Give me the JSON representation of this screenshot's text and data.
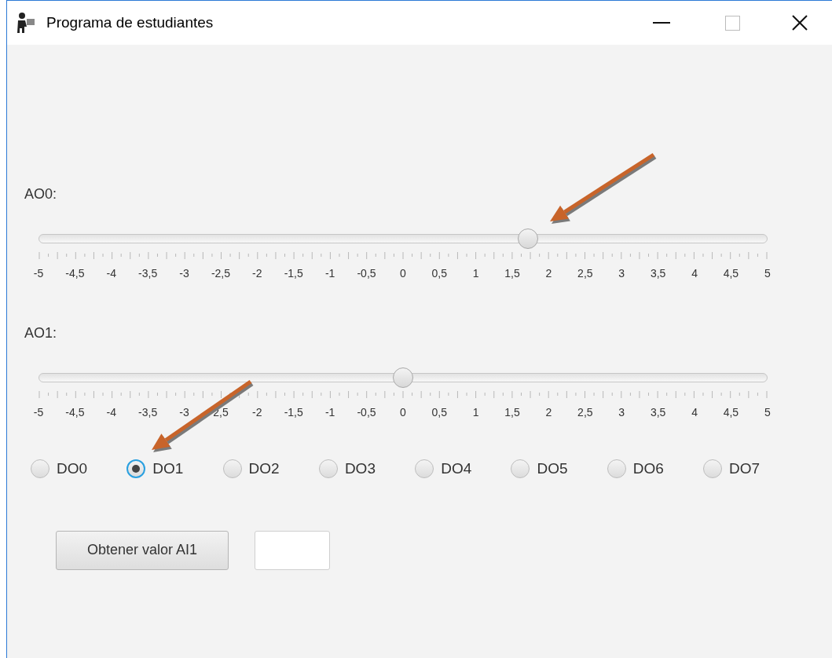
{
  "window": {
    "title": "Programa de estudiantes"
  },
  "sliders": [
    {
      "label": "AO0:",
      "level": 0.672,
      "tick_labels": [
        "-5",
        "-4,5",
        "-4",
        "-3,5",
        "-3",
        "-2,5",
        "-2",
        "-1,5",
        "-1",
        "-0,5",
        "0",
        "0,5",
        "1",
        "1,5",
        "2",
        "2,5",
        "3",
        "3,5",
        "4",
        "4,5",
        "5"
      ]
    },
    {
      "label": "AO1:",
      "level": 0.5,
      "tick_labels": [
        "-5",
        "-4,5",
        "-4",
        "-3,5",
        "-3",
        "2,5",
        "-2",
        "-1,5",
        "-1",
        "-0,5",
        "0",
        "0,5",
        "1",
        "1,5",
        "2",
        "2,5",
        "3",
        "3,5",
        "4",
        "4,5",
        "5"
      ]
    }
  ],
  "radios": [
    {
      "label": "DO0",
      "selected": false
    },
    {
      "label": "DO1",
      "selected": true
    },
    {
      "label": "DO2",
      "selected": false
    },
    {
      "label": "DO3",
      "selected": false
    },
    {
      "label": "DO4",
      "selected": false
    },
    {
      "label": "DO5",
      "selected": false
    },
    {
      "label": "DO6",
      "selected": false
    },
    {
      "label": "DO7",
      "selected": false
    }
  ],
  "button": {
    "label": "Obtener valor AI1"
  }
}
